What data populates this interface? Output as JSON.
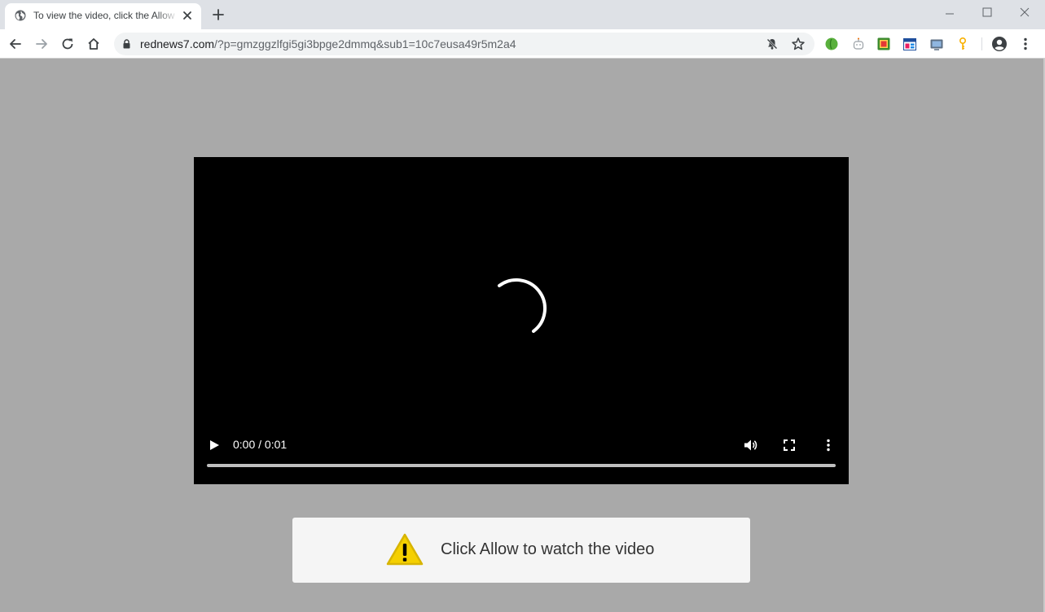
{
  "browser": {
    "tab": {
      "title": "To view the video, click the Allow button",
      "favicon": "globe-icon"
    },
    "address": {
      "domain": "rednews7.com",
      "path": "/?p=gmzggzlfgi5gi3bpge2dmmq&sub1=10c7eusa49r5m2a4"
    },
    "extensions": [
      "green-circle-extension-icon",
      "robot-extension-icon",
      "green-square-extension-icon",
      "calendar-extension-icon",
      "tv-extension-icon",
      "key-extension-icon"
    ]
  },
  "player": {
    "time": "0:00 / 0:01",
    "progress": 0.0
  },
  "notice": {
    "text": "Click Allow to watch the video",
    "icon": "warning-icon"
  },
  "colors": {
    "page_background": "#a9a9a9",
    "player_background": "#000000",
    "notice_background": "#f5f5f5",
    "warning_yellow": "#f5d000"
  }
}
